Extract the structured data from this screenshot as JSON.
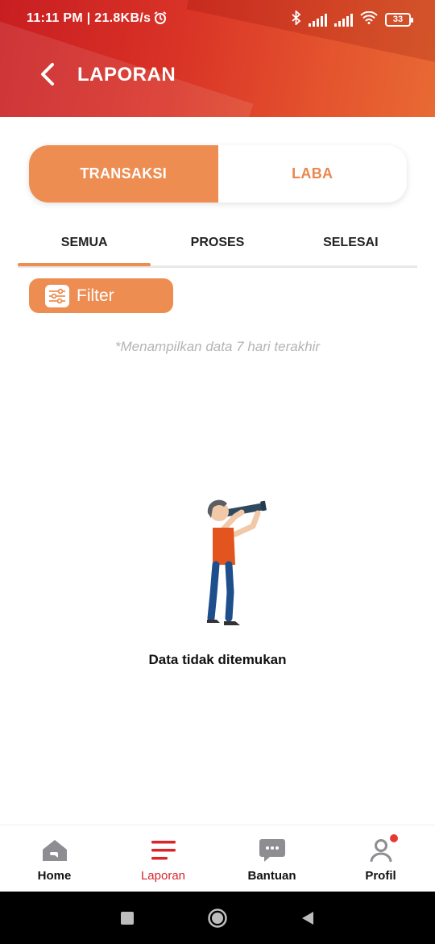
{
  "status_bar": {
    "time_speed": "11:11 PM | 21.8KB/s",
    "battery": "33"
  },
  "app_bar": {
    "title": "LAPORAN"
  },
  "segment": {
    "options": [
      "TRANSAKSI",
      "LABA"
    ],
    "selected": "TRANSAKSI"
  },
  "tabs": {
    "items": [
      "SEMUA",
      "PROSES",
      "SELESAI"
    ],
    "selected": "SEMUA"
  },
  "filter": {
    "label": "Filter"
  },
  "note": "*Menampilkan data 7 hari terakhir",
  "empty_state": {
    "message": "Data tidak ditemukan"
  },
  "bottom_nav": {
    "items": [
      {
        "label": "Home",
        "icon": "home-icon"
      },
      {
        "label": "Laporan",
        "icon": "report-icon"
      },
      {
        "label": "Bantuan",
        "icon": "chat-icon"
      },
      {
        "label": "Profil",
        "icon": "profile-icon"
      }
    ],
    "active": "Laporan"
  },
  "colors": {
    "header_start": "#c81e22",
    "header_end": "#e86a34",
    "accent": "#ee8d52",
    "nav_active": "#d9262b",
    "note_text": "#b4b4b4"
  }
}
